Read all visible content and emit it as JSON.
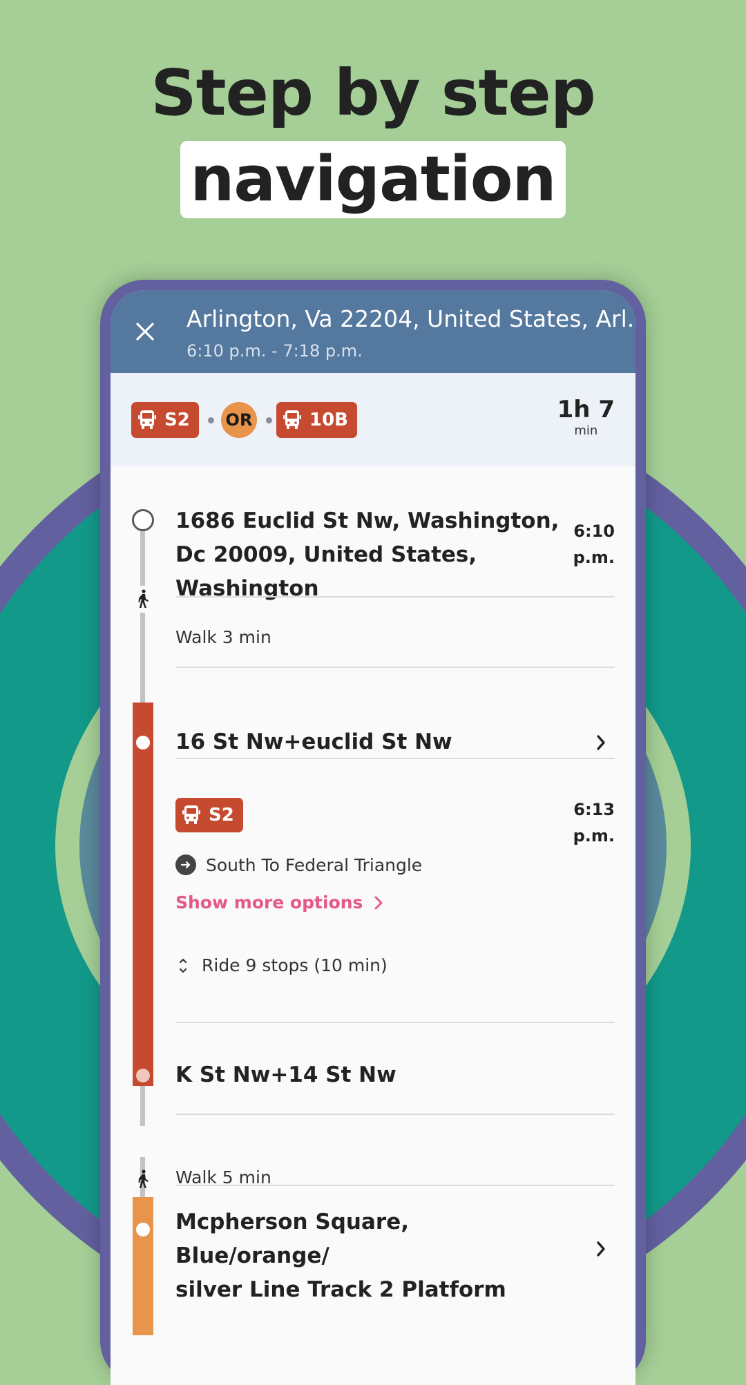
{
  "promo": {
    "headline_line1": "Step by step",
    "headline_line2": "navigation"
  },
  "colors": {
    "background": "#a5cf96",
    "header": "#55789e",
    "bus_line": "#c64a30",
    "orange_line": "#e8944a",
    "link": "#e4588a",
    "phone_frame": "#6360a0"
  },
  "header": {
    "close_icon": "close-icon",
    "destination": "Arlington, Va 22204, United States, Arl...",
    "time_range": "6:10 p.m. - 7:18 p.m."
  },
  "summary": {
    "legs": [
      {
        "type": "bus",
        "icon": "bus-icon",
        "label": "S2"
      },
      {
        "type": "metro",
        "label": "OR"
      },
      {
        "type": "bus",
        "icon": "bus-icon",
        "label": "10B"
      }
    ],
    "duration_value": "1h 7",
    "duration_unit": "min"
  },
  "steps": {
    "origin": {
      "title": "1686 Euclid St Nw, Washington, Dc 20009, United States, Washington",
      "title_lines": [
        "1686 Euclid St Nw, Washington,",
        "Dc 20009, United States,",
        "Washington"
      ],
      "time_line1": "6:10",
      "time_line2": "p.m."
    },
    "walk1": {
      "icon": "walk-icon",
      "label": "Walk 3 min"
    },
    "board_stop": {
      "title": "16 St Nw+euclid St Nw",
      "icon": "chevron-right-icon"
    },
    "bus_leg": {
      "route_icon": "bus-icon",
      "route": "S2",
      "time_line1": "6:13",
      "time_line2": "p.m.",
      "direction_icon": "arrow-right-circle-icon",
      "direction": "South To Federal Triangle",
      "more_options": "Show more options",
      "ride_icon": "expand-icon",
      "ride_info": "Ride 9 stops (10 min)"
    },
    "alight_stop": {
      "title": "K St Nw+14 St Nw"
    },
    "walk2": {
      "icon": "walk-icon",
      "label": "Walk 5 min"
    },
    "metro_stop": {
      "title_lines": [
        "Mcpherson Square, Blue/orange/",
        "silver Line Track 2 Platform"
      ],
      "icon": "chevron-right-icon"
    }
  }
}
